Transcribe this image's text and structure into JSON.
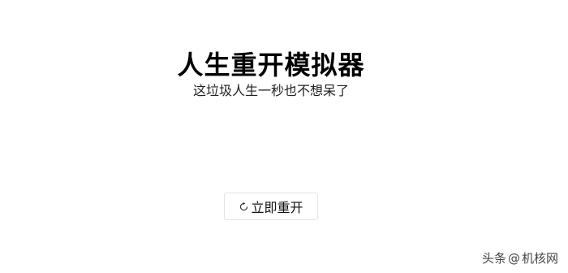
{
  "header": {
    "title": "人生重开模拟器",
    "subtitle": "这垃圾人生一秒也不想呆了"
  },
  "main": {
    "restart_label": "立即重开",
    "restart_icon": "refresh-icon"
  },
  "watermark": {
    "source": "头条",
    "at": "@",
    "name": "机核网"
  },
  "colors": {
    "background": "#ffffff",
    "text": "#111111",
    "button_border": "#e3e3e3"
  }
}
